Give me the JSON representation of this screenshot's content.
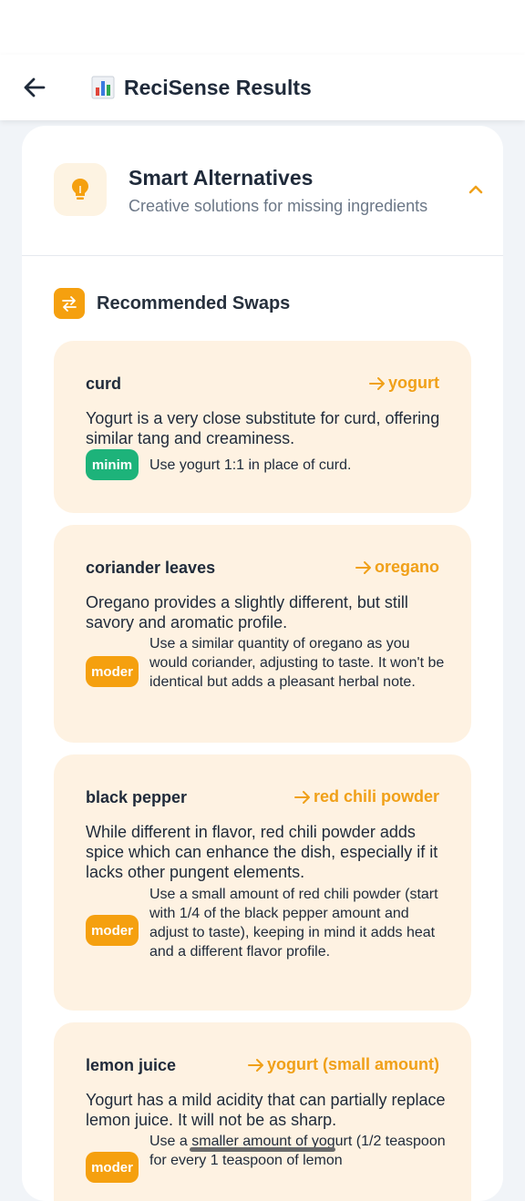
{
  "app": {
    "title": "ReciSense Results",
    "title_emoji": "📊"
  },
  "panel": {
    "title": "Smart Alternatives",
    "subtitle": "Creative solutions for missing ingredients",
    "section_title": "Recommended Swaps"
  },
  "swaps": [
    {
      "original": "curd",
      "substitute": "yogurt",
      "description": "Yogurt is a very close substitute for curd, offering similar tang and creaminess.",
      "badge": "minim",
      "badge_color": "#1db37a",
      "instruction": "Use yogurt 1:1 in place of curd."
    },
    {
      "original": "coriander leaves",
      "substitute": "oregano",
      "description": "Oregano provides a slightly different, but still savory and aromatic profile.",
      "badge": "moder",
      "badge_color": "#f5a00f",
      "instruction": "Use a similar quantity of oregano as you would coriander, adjusting to taste.  It won't be identical but adds a pleasant herbal note."
    },
    {
      "original": "black pepper",
      "substitute": "red chili powder",
      "description": "While different in flavor, red chili powder adds spice which can enhance the dish, especially if it lacks other pungent elements.",
      "badge": "moder",
      "badge_color": "#f5a00f",
      "instruction": "Use a small amount of red chili powder (start with 1/4 of the black pepper amount and adjust to taste), keeping in mind it adds heat and a different flavor profile."
    },
    {
      "original": "lemon juice",
      "substitute": "yogurt (small amount)",
      "description": "Yogurt has a mild acidity that can partially replace lemon juice.  It will not be as sharp.",
      "badge": "moder",
      "badge_color": "#f5a00f",
      "instruction": "Use a smaller amount of yogurt (1/2 teaspoon for every 1 teaspoon of lemon"
    }
  ],
  "colors": {
    "accent": "#f5a00f",
    "card_bg": "#fef2e2",
    "minimal_badge": "#1db37a"
  }
}
